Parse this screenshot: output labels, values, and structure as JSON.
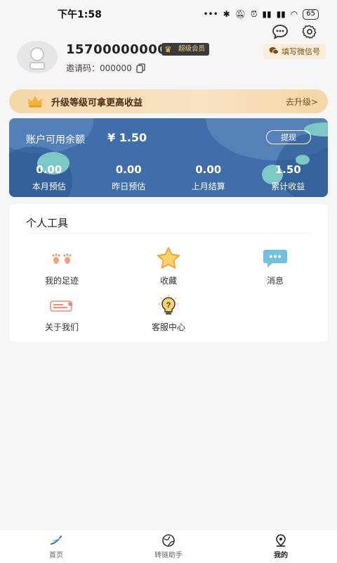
{
  "status_bar": {
    "time": "下午1:58",
    "battery": "65"
  },
  "profile": {
    "phone": "15700000000",
    "vip_badge": "超级会员",
    "invite_code": "邀请码：000000",
    "wechat_button": "填写微信号"
  },
  "upgrade": {
    "text": "升级等级可拿更高收益",
    "link": "去升级>"
  },
  "balance": {
    "label": "账户可用余额",
    "amount": "¥ 1.50",
    "withdraw_button": "提现",
    "stats": [
      {
        "value": "0.00",
        "label": "本月预估"
      },
      {
        "value": "0.00",
        "label": "昨日预估"
      },
      {
        "value": "0.00",
        "label": "上月结算"
      },
      {
        "value": "1.50",
        "label": "累计收益"
      }
    ]
  },
  "tools": {
    "title": "个人工具",
    "items": [
      {
        "label": "我的足迹",
        "icon": "footprint-icon"
      },
      {
        "label": "收藏",
        "icon": "star-icon"
      },
      {
        "label": "消息",
        "icon": "chat-bubble-icon"
      },
      {
        "label": "关于我们",
        "icon": "about-us-icon"
      },
      {
        "label": "客服中心",
        "icon": "help-bulb-icon"
      }
    ]
  },
  "tabbar": {
    "tabs": [
      {
        "label": "首页",
        "icon": "home-icon"
      },
      {
        "label": "转链助手",
        "icon": "globe-icon"
      },
      {
        "label": "我的",
        "icon": "location-pin-icon"
      }
    ],
    "active_index": 2
  },
  "colors": {
    "card_blue": "#3f6eab",
    "gold_light": "#f8e3c3",
    "accent_gold": "#f3c56a"
  }
}
